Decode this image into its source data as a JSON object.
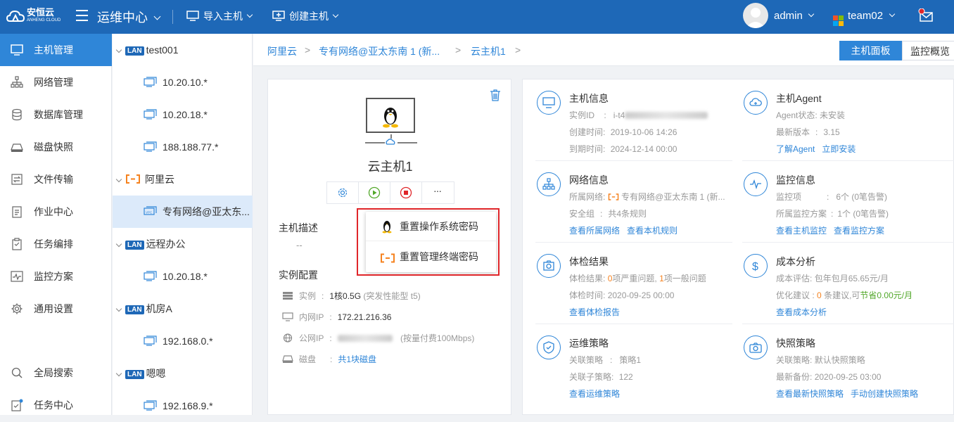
{
  "topbar": {
    "logo_text": "安恒云",
    "logo_sub": "ANHENG CLOUD",
    "app_title": "运维中心",
    "import_host": "导入主机",
    "create_host": "创建主机",
    "user": "admin",
    "team": "team02"
  },
  "sidebar": {
    "items": [
      {
        "label": "主机管理",
        "icon": "monitor-icon",
        "active": true
      },
      {
        "label": "网络管理",
        "icon": "network-icon"
      },
      {
        "label": "数据库管理",
        "icon": "database-icon"
      },
      {
        "label": "磁盘快照",
        "icon": "disk-icon"
      },
      {
        "label": "文件传输",
        "icon": "file-transfer-icon"
      },
      {
        "label": "作业中心",
        "icon": "clipboard-icon"
      },
      {
        "label": "任务编排",
        "icon": "task-icon"
      },
      {
        "label": "监控方案",
        "icon": "pulse-icon"
      },
      {
        "label": "通用设置",
        "icon": "gear-icon"
      }
    ],
    "bottom": [
      {
        "label": "全局搜索",
        "icon": "search-icon"
      },
      {
        "label": "任务中心",
        "icon": "task-center-icon"
      }
    ]
  },
  "tree": {
    "lan_badge": "LAN",
    "nodes": [
      {
        "label": "test001",
        "type": "lan"
      },
      {
        "label": "10.20.10.*",
        "type": "host"
      },
      {
        "label": "10.20.18.*",
        "type": "host"
      },
      {
        "label": "188.188.77.*",
        "type": "host"
      },
      {
        "label": "阿里云",
        "type": "cloud"
      },
      {
        "label": "专有网络@亚太东...",
        "type": "vpc",
        "active": true
      },
      {
        "label": "远程办公",
        "type": "lan"
      },
      {
        "label": "10.20.18.*",
        "type": "host"
      },
      {
        "label": "机房A",
        "type": "lan"
      },
      {
        "label": "192.168.0.*",
        "type": "host"
      },
      {
        "label": "嗯嗯",
        "type": "lan"
      },
      {
        "label": "192.168.9.*",
        "type": "host"
      }
    ]
  },
  "breadcrumb": {
    "items": [
      "阿里云",
      "专有网络@亚太东南 1 (新...",
      "云主机1"
    ]
  },
  "tabs": {
    "host_panel": "主机面板",
    "monitor_overview": "监控概览"
  },
  "host": {
    "name": "云主机1",
    "desc_label": "主机描述",
    "desc_value": "--",
    "config_label": "实例配置",
    "instance_label": "实例",
    "instance_value": "1核0.5G",
    "instance_note": "(突发性能型 t5)",
    "private_ip_label": "内网IP",
    "private_ip": "172.21.216.36",
    "public_ip_label": "公网IP",
    "public_ip_note": "(按量付费100Mbps)",
    "disk_label": "磁盘",
    "disk_value": "共1块磁盘",
    "colon": ":"
  },
  "dropdown": {
    "reset_os_password": "重置操作系统密码",
    "reset_terminal_password": "重置管理终端密码"
  },
  "info": {
    "host_info": {
      "title": "主机信息",
      "instance_id_label": "实例ID",
      "instance_id": "i-t4",
      "created_label": "创建时间",
      "created": "2019-10-06 14:26",
      "expire_label": "到期时间",
      "expire": "2024-12-14 00:00"
    },
    "agent": {
      "title": "主机Agent",
      "status_label": "Agent状态",
      "status": "未安装",
      "version_label": "最新版本",
      "version": "3.15",
      "learn": "了解Agent",
      "install": "立即安装"
    },
    "network": {
      "title": "网络信息",
      "vpc_label": "所属网络",
      "vpc": "专有网络@亚太东南 1 (新...",
      "sg_label": "安全组",
      "sg": "共4条规则",
      "link1": "查看所属网络",
      "link2": "查看本机规则"
    },
    "monitor": {
      "title": "监控信息",
      "items_label": "监控项",
      "items": "6个",
      "items_note": "(0笔告警)",
      "plan_label": "所属监控方案",
      "plan": "1个",
      "plan_note": "(0笔告警)",
      "link1": "查看主机监控",
      "link2": "查看监控方案"
    },
    "health": {
      "title": "体检结果",
      "result_label": "体检结果",
      "serious_count": "0",
      "serious_text": "项严重问题,",
      "normal_count": "1",
      "normal_text": "项一般问题",
      "time_label": "体检时间",
      "time": "2020-09-25 00:00",
      "link": "查看体检报告"
    },
    "cost": {
      "title": "成本分析",
      "eval_label": "成本评估",
      "eval": "包年包月65.65元/月",
      "opt_label": "优化建议",
      "opt_count": "0",
      "opt_text": "条建议,可",
      "save_text": "节省0.00元/月",
      "link": "查看成本分析"
    },
    "ops": {
      "title": "运维策略",
      "policy_label": "关联策略",
      "policy": "策略1",
      "sub_label": "关联子策略",
      "sub": "122",
      "link": "查看运维策略"
    },
    "snapshot": {
      "title": "快照策略",
      "policy_label": "关联策略",
      "policy": "默认快照策略",
      "backup_label": "最新备份",
      "backup": "2020-09-25 03:00",
      "link1": "查看最新快照策略",
      "link2": "手动创建快照策略"
    }
  },
  "colors": {
    "topbar": "#1e68b7",
    "accent": "#2f86d8",
    "danger_box": "#e0262a",
    "orange": "#f5821f",
    "green": "#52a82a"
  }
}
